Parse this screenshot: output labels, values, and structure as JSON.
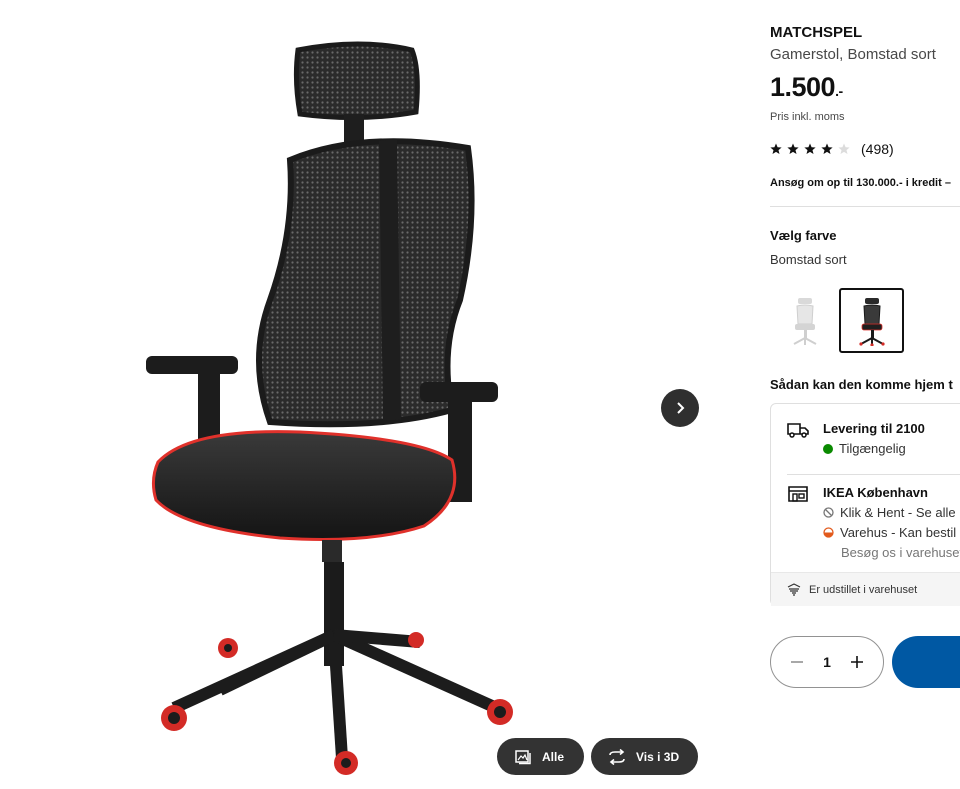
{
  "gallery": {
    "image_alt": "Gamerstol, Bomstad sort",
    "buttons": {
      "all_label": "Alle",
      "view3d_label": "Vis i 3D"
    }
  },
  "product": {
    "brand": "MATCHSPEL",
    "subtitle": "Gamerstol, Bomstad sort",
    "price_main": "1.500",
    "price_suffix": ".-",
    "vat_note": "Pris inkl. moms",
    "rating": {
      "value": 4,
      "max": 5,
      "count": "(498)"
    },
    "credit_text": "Ansøg om op til 130.000.- i kredit –"
  },
  "color": {
    "label": "Vælg farve",
    "selected": "Bomstad sort",
    "options": [
      {
        "name": "Bomstad hvid",
        "selected": false
      },
      {
        "name": "Bomstad sort",
        "selected": true
      }
    ]
  },
  "delivery": {
    "heading": "Sådan kan den komme hjem t",
    "home": {
      "title": "Levering til 2100",
      "status": "Tilgængelig"
    },
    "store": {
      "title": "IKEA København",
      "click_collect": "Klik & Hent - Se alle",
      "warehouse": "Varehus - Kan bestil",
      "visit": "Besøg os i varehuset"
    },
    "showroom": "Er udstillet i varehuset"
  },
  "cart": {
    "quantity": "1"
  },
  "colors": {
    "accent_blue": "#0058a3",
    "available_green": "#0a8a00",
    "chair_accent_red": "#e0312b",
    "warning_orange": "#e25a1c"
  }
}
